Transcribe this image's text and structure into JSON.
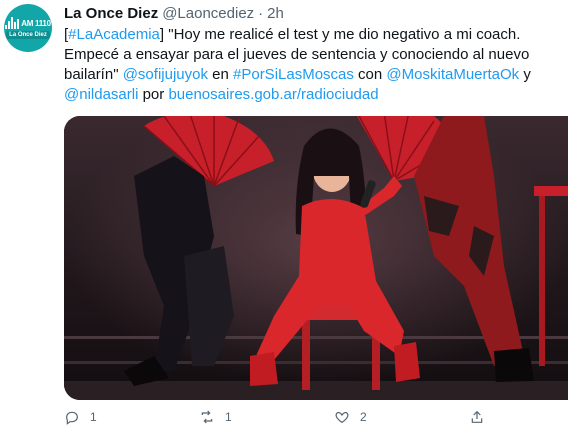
{
  "tweet": {
    "author": {
      "display_name": "La Once Diez",
      "handle": "@Laoncediez",
      "separator": "·",
      "time": "2h",
      "avatar": {
        "frequency": "AM 1110",
        "station": "La Once Diez",
        "color": "#13a6a8"
      }
    },
    "text": {
      "p1": "[",
      "hashtag_academia": "#LaAcademia",
      "p2": "] \"Hoy me realicé el test y me dio negativo a mi coach. Empecé a ensayar para el jueves de sentencia y conociendo al nuevo bailarín\" ",
      "mention_sofi": "@sofijujuyok",
      "p3": " en ",
      "hashtag_moscas": "#PorSiLasMoscas",
      "p4": " con ",
      "mention_moskita": "@MoskitaMuertaOk",
      "p5": " y ",
      "mention_nilda": "@nildasarli",
      "p6": " por ",
      "url": "buenosaires.gob.ar/radiociudad"
    },
    "media": {
      "icon": "photo-of-dancer-in-red-on-stage"
    },
    "actions": {
      "reply_count": "1",
      "retweet_count": "1",
      "like_count": "2",
      "reply_icon": "reply-icon",
      "retweet_icon": "retweet-icon",
      "like_icon": "heart-icon",
      "share_icon": "share-icon"
    },
    "colors": {
      "link": "#1d9bf0",
      "text": "#0f1419",
      "muted": "#536471"
    }
  }
}
